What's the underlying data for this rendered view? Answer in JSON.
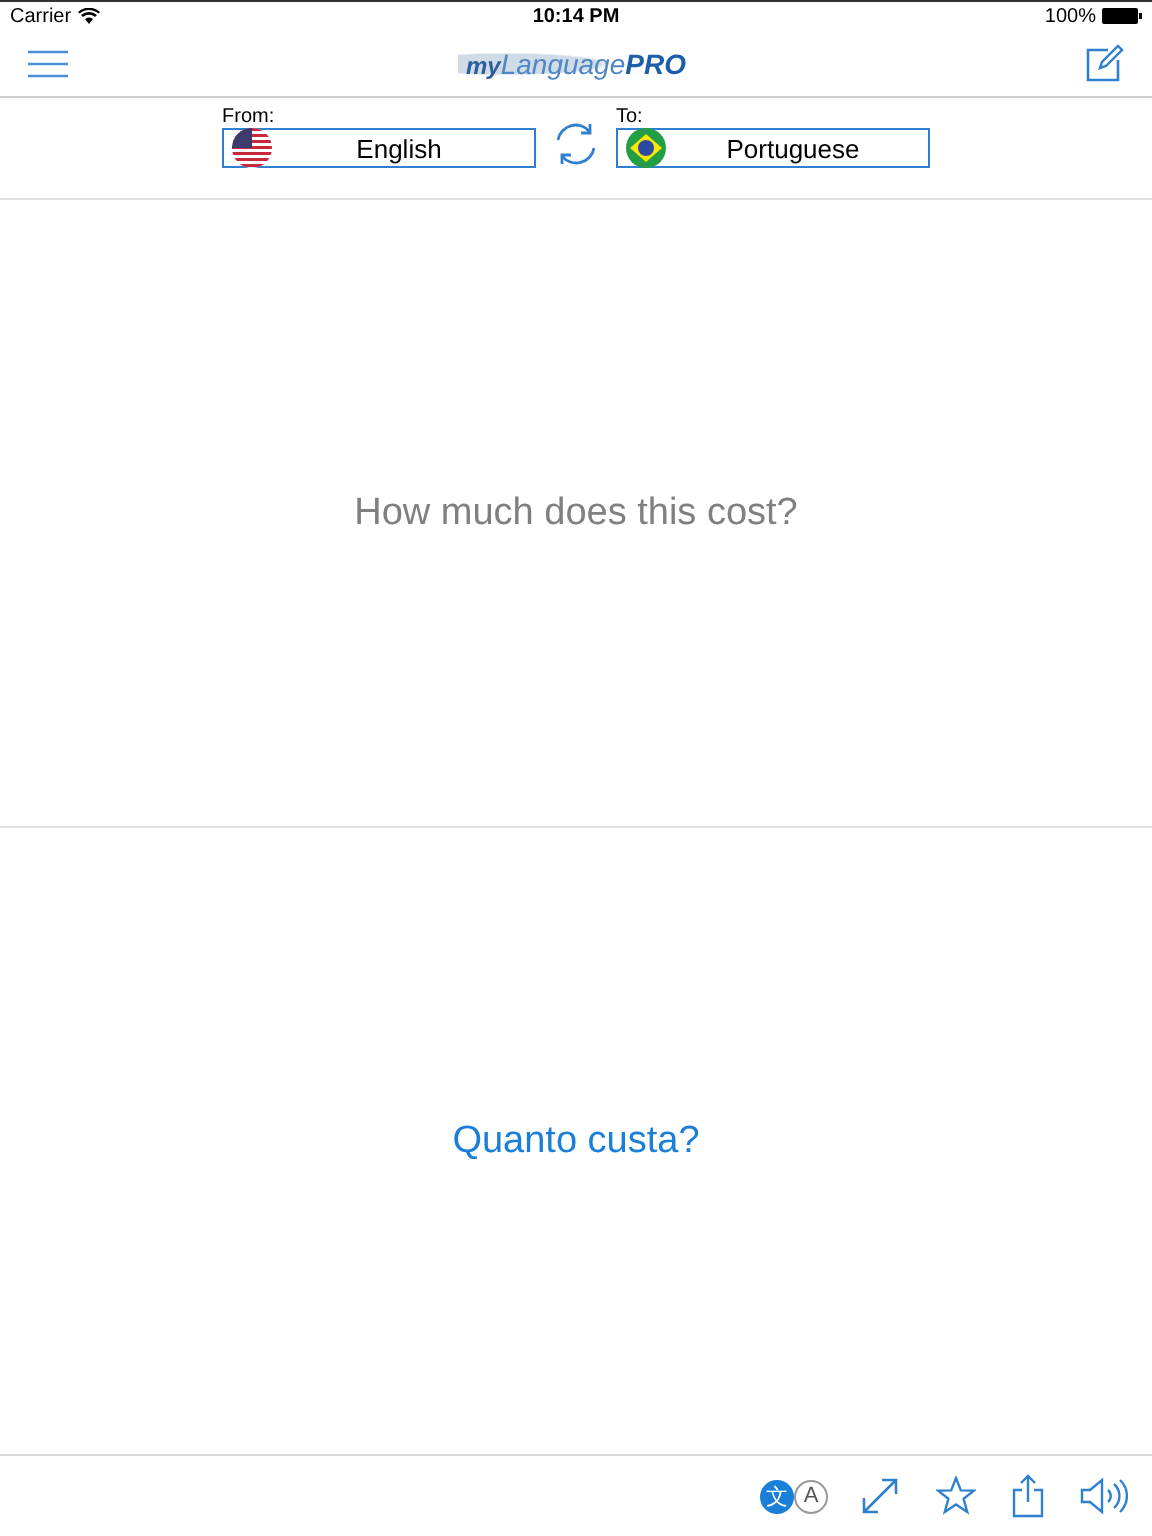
{
  "status_bar": {
    "carrier": "Carrier",
    "time": "10:14 PM",
    "battery": "100%"
  },
  "logo": {
    "prefix": "my",
    "name": "Language",
    "suffix": "PRO"
  },
  "from": {
    "label": "From:",
    "language": "English",
    "flag": {
      "kind": "us"
    }
  },
  "to": {
    "label": "To:",
    "language": "Portuguese",
    "flag": {
      "kind": "br"
    }
  },
  "source_text": "How much does this cost?",
  "translation": "Quanto custa?",
  "script_toggle": {
    "native": "文",
    "latin": "A",
    "native_selected": true
  }
}
